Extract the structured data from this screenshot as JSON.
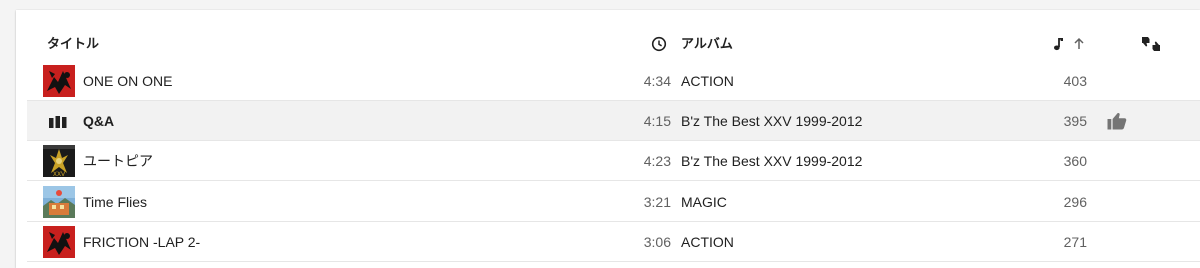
{
  "header": {
    "title_col": "タイトル",
    "duration_icon": "clock-icon",
    "album_col": "アルバム",
    "plays_icon": "music-note-icon",
    "sort_icon": "arrow-up-icon",
    "rating_icon": "thumbs-up-down-icon"
  },
  "tracks": [
    {
      "title": "ONE ON ONE",
      "duration": "4:34",
      "album": "ACTION",
      "plays": "403",
      "art": "action"
    },
    {
      "title": "Q&A",
      "duration": "4:15",
      "album": "B'z The Best XXV 1999-2012",
      "plays": "395",
      "playing": true,
      "liked": true
    },
    {
      "title": "ユートピア",
      "duration": "4:23",
      "album": "B'z The Best XXV 1999-2012",
      "plays": "360",
      "art": "best-xxv"
    },
    {
      "title": "Time Flies",
      "duration": "3:21",
      "album": "MAGIC",
      "plays": "296",
      "art": "magic"
    },
    {
      "title": "FRICTION -LAP 2-",
      "duration": "3:06",
      "album": "ACTION",
      "plays": "271",
      "art": "action"
    }
  ],
  "colors": {
    "action_red": "#c8201e",
    "best_dark": "#1a1a1a",
    "magic_blue": "#5a8fc0",
    "icon_grey": "#757575"
  }
}
